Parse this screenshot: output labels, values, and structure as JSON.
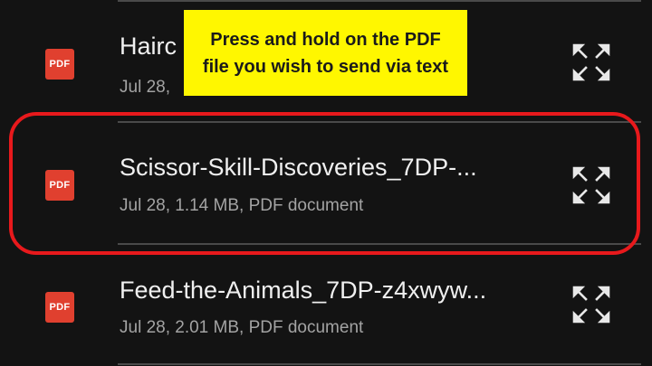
{
  "files": [
    {
      "name": "Hairc",
      "meta": "Jul 28,",
      "type_badge": "PDF",
      "icon": "expand-arrows-icon"
    },
    {
      "name": "Scissor-Skill-Discoveries_7DP-...",
      "meta": "Jul 28, 1.14 MB, PDF document",
      "type_badge": "PDF",
      "icon": "expand-arrows-icon"
    },
    {
      "name": "Feed-the-Animals_7DP-z4xwyw...",
      "meta": "Jul 28, 2.01 MB, PDF document",
      "type_badge": "PDF",
      "icon": "expand-arrows-icon"
    }
  ],
  "callout": {
    "line1": "Press and hold on the PDF",
    "line2": "file you wish to send via text"
  },
  "colors": {
    "background": "#131313",
    "pdf_badge": "#e0402f",
    "highlight": "#e8191c",
    "callout_bg": "#fff700"
  }
}
